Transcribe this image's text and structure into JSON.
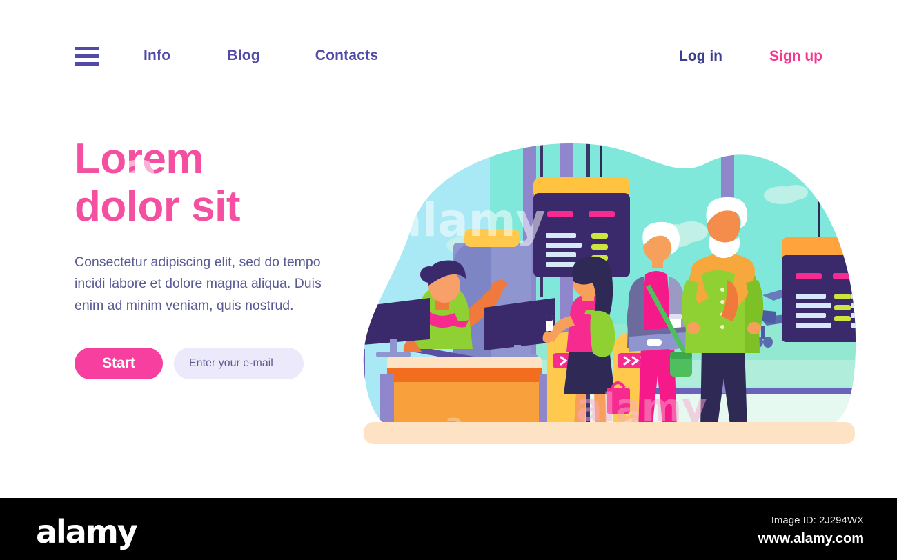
{
  "nav": {
    "menu_icon": "hamburger-menu-icon",
    "links": [
      {
        "label": "Info"
      },
      {
        "label": "Blog"
      },
      {
        "label": "Contacts"
      }
    ],
    "login_label": "Log in",
    "signup_label": "Sign up"
  },
  "hero": {
    "title_line1": "Lorem",
    "title_line2": "dolor sit",
    "body": "Consectetur adipiscing elit, sed do tempo incidi labore et dolore magna aliqua. Duis enim ad minim veniam, quis nostrud.",
    "start_label": "Start",
    "email_placeholder": "Enter your e-mail"
  },
  "illustration": {
    "alt": "airport-check-in-illustration",
    "scene": "Airport check-in counter with agent, travellers passing e-gates, elderly couple, departure boards and airplane",
    "gate_sign_label": ">>",
    "elements": [
      "check-in-desk",
      "check-in-agent",
      "monitor-left",
      "monitor-right",
      "baggage-column",
      "e-gate-left",
      "e-gate-right",
      "traveller-woman-backpack",
      "elderly-woman",
      "elderly-man",
      "departure-board-left",
      "departure-board-right",
      "airplane",
      "cloud",
      "terminal-pillar"
    ]
  },
  "colors": {
    "accent_pink": "#f73fa0",
    "nav_purple": "#514aa8",
    "body_text": "#5b5b94",
    "heading_pink": "#f44fa0",
    "input_bg": "#eceafa",
    "illustration_sky": "#a8e8f5",
    "illustration_mint": "#7fe8d8",
    "gate_yellow": "#ffc94d",
    "desk_orange": "#f7a03c",
    "board_navy": "#3b2a6b",
    "floor_cream": "#fde3c4"
  },
  "watermark": {
    "text": "alamy",
    "letter": "a"
  },
  "footer": {
    "logo": "alamy",
    "image_id": "Image ID: 2J294WX",
    "url": "www.alamy.com"
  }
}
